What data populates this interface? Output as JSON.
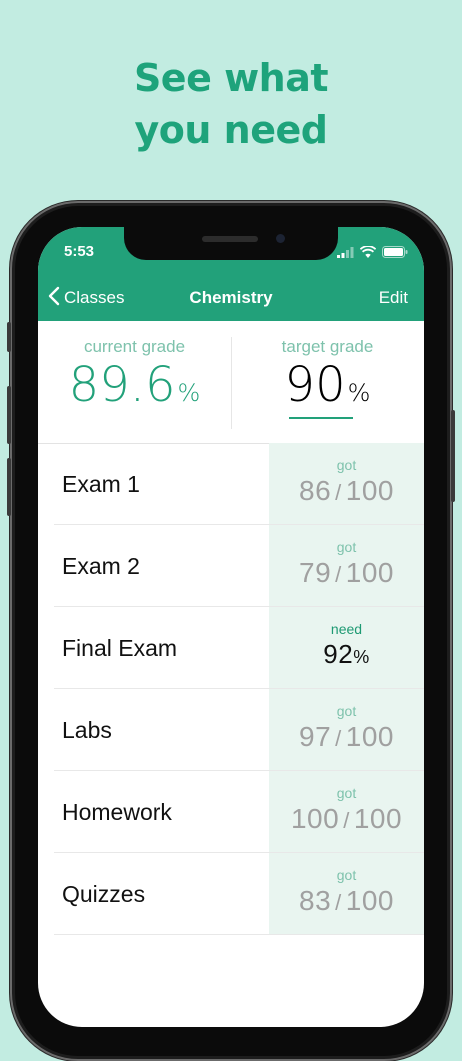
{
  "headline": {
    "line1": "See what",
    "line2": "you need"
  },
  "status_bar": {
    "time": "5:53"
  },
  "nav": {
    "back_label": "Classes",
    "title": "Chemistry",
    "edit_label": "Edit"
  },
  "summary": {
    "current_label": "current grade",
    "current_value": "89.6",
    "target_label": "target grade",
    "target_value": "90",
    "percent_symbol": "%"
  },
  "rows": [
    {
      "name": "Exam 1",
      "tag": "got",
      "score": "86",
      "out_of": "100"
    },
    {
      "name": "Exam 2",
      "tag": "got",
      "score": "79",
      "out_of": "100"
    },
    {
      "name": "Final Exam",
      "tag": "need",
      "score": "92",
      "unit": "%"
    },
    {
      "name": "Labs",
      "tag": "got",
      "score": "97",
      "out_of": "100"
    },
    {
      "name": "Homework",
      "tag": "got",
      "score": "100",
      "out_of": "100"
    },
    {
      "name": "Quizzes",
      "tag": "got",
      "score": "83",
      "out_of": "100"
    }
  ],
  "colors": {
    "accent": "#22a17a",
    "background": "#c2ece1",
    "score_cell": "#e9f5f0"
  },
  "slash": "/"
}
